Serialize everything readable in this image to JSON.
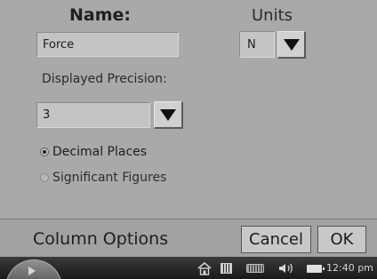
{
  "form": {
    "name_label": "Name:",
    "name_value": "Force",
    "units_label": "Units",
    "units_value": "N",
    "precision_label": "Displayed Precision:",
    "precision_value": "3",
    "options": [
      {
        "label": "Decimal Places",
        "selected": true
      },
      {
        "label": "Significant Figures",
        "selected": false
      }
    ]
  },
  "footer": {
    "title": "Column Options",
    "cancel_label": "Cancel",
    "ok_label": "OK"
  },
  "taskbar": {
    "clock": "12:40 pm",
    "tray_icons": [
      "home-icon",
      "grid-icon",
      "keyboard-icon",
      "volume-icon",
      "battery-icon"
    ]
  }
}
